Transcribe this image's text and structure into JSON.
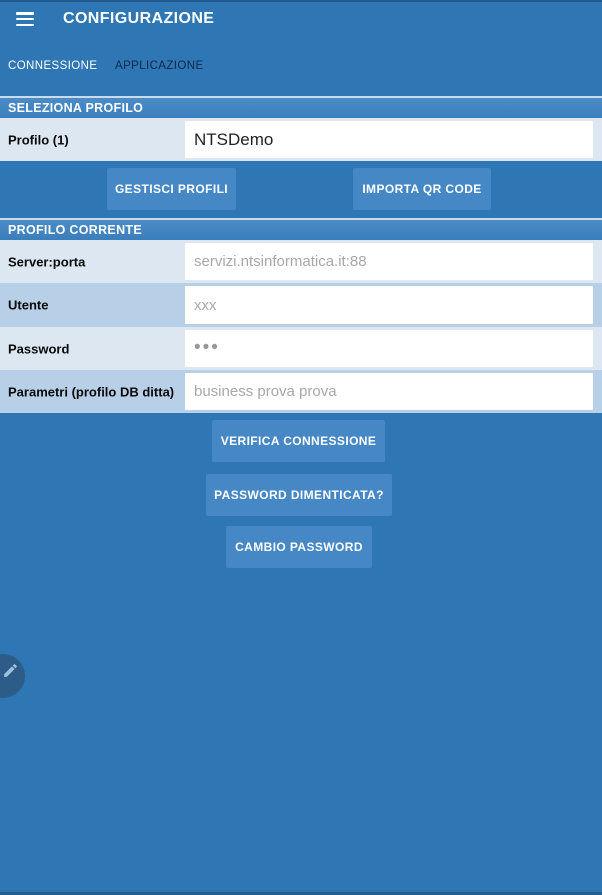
{
  "app": {
    "title": "CONFIGURAZIONE"
  },
  "tabs": [
    {
      "label": "CONNESSIONE",
      "active": true
    },
    {
      "label": "APPLICAZIONE",
      "active": false
    }
  ],
  "sections": {
    "select_profile": {
      "header": "SELEZIONA PROFILO",
      "profile_label": "Profilo (1)",
      "profile_value": "NTSDemo",
      "buttons": {
        "manage": "GESTISCI PROFILI",
        "import_qr": "IMPORTA QR CODE"
      }
    },
    "current_profile": {
      "header": "PROFILO CORRENTE",
      "fields": [
        {
          "label": "Server:porta",
          "placeholder": "servizi.ntsinformatica.it:88"
        },
        {
          "label": "Utente",
          "placeholder": "xxx"
        },
        {
          "label": "Password",
          "placeholder": "•••"
        },
        {
          "label": "Parametri (profilo DB ditta)",
          "placeholder": "business prova prova"
        }
      ]
    }
  },
  "actions": {
    "verify": "VERIFICA CONNESSIONE",
    "forgot": "PASSWORD DIMENTICATA?",
    "change": "CAMBIO PASSWORD"
  },
  "fab": {
    "icon": "pencil-icon"
  },
  "colors": {
    "background": "#2e76b4",
    "section_header": "#4084c1",
    "row_light": "#dce7f2",
    "row_shade": "#b7d0e7",
    "button": "#4588c5",
    "active_tab_text": "#ffffff",
    "inactive_tab_text": "#10294a",
    "placeholder_text": "#a8a8a8",
    "fab_circle": "#2d5c88"
  }
}
